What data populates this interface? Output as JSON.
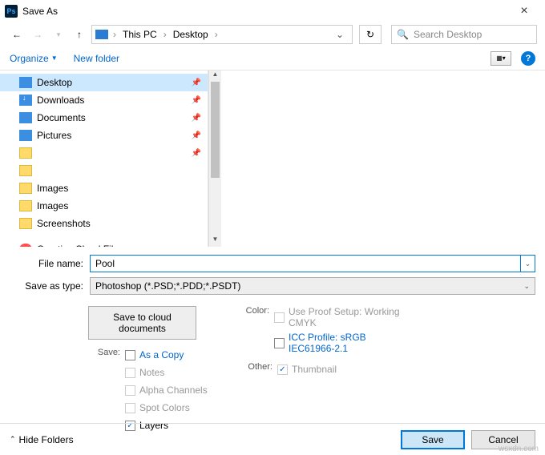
{
  "window": {
    "title": "Save As"
  },
  "nav": {
    "crumbs": [
      "This PC",
      "Desktop"
    ],
    "search_placeholder": "Search Desktop"
  },
  "toolbar": {
    "organize": "Organize",
    "new_folder": "New folder"
  },
  "tree": {
    "items": [
      {
        "label": "Desktop",
        "icon": "desktop",
        "pinned": true,
        "selected": true
      },
      {
        "label": "Downloads",
        "icon": "download",
        "pinned": true
      },
      {
        "label": "Documents",
        "icon": "docs",
        "pinned": true
      },
      {
        "label": "Pictures",
        "icon": "pics",
        "pinned": true
      },
      {
        "label": "",
        "icon": "folder",
        "pinned": true
      },
      {
        "label": "",
        "icon": "folder"
      },
      {
        "label": "Images",
        "icon": "folder"
      },
      {
        "label": "Images",
        "icon": "folder"
      },
      {
        "label": "Screenshots",
        "icon": "folder"
      },
      {
        "label": "Creative Cloud Files",
        "icon": "cc",
        "gap": true
      }
    ]
  },
  "fields": {
    "filename_label": "File name:",
    "filename_value": "Pool",
    "savetype_label": "Save as type:",
    "savetype_value": "Photoshop (*.PSD;*.PDD;*.PSDT)"
  },
  "options": {
    "cloud_button": "Save to cloud documents",
    "save_label": "Save:",
    "as_a_copy": "As a Copy",
    "notes": "Notes",
    "alpha": "Alpha Channels",
    "spot": "Spot Colors",
    "layers": "Layers",
    "color_label": "Color:",
    "proof_setup": "Use Proof Setup: Working CMYK",
    "icc": "ICC Profile:  sRGB IEC61966-2.1",
    "other_label": "Other:",
    "thumbnail": "Thumbnail"
  },
  "footer": {
    "hide_folders": "Hide Folders",
    "save": "Save",
    "cancel": "Cancel"
  },
  "watermark": "wsxdn.com"
}
